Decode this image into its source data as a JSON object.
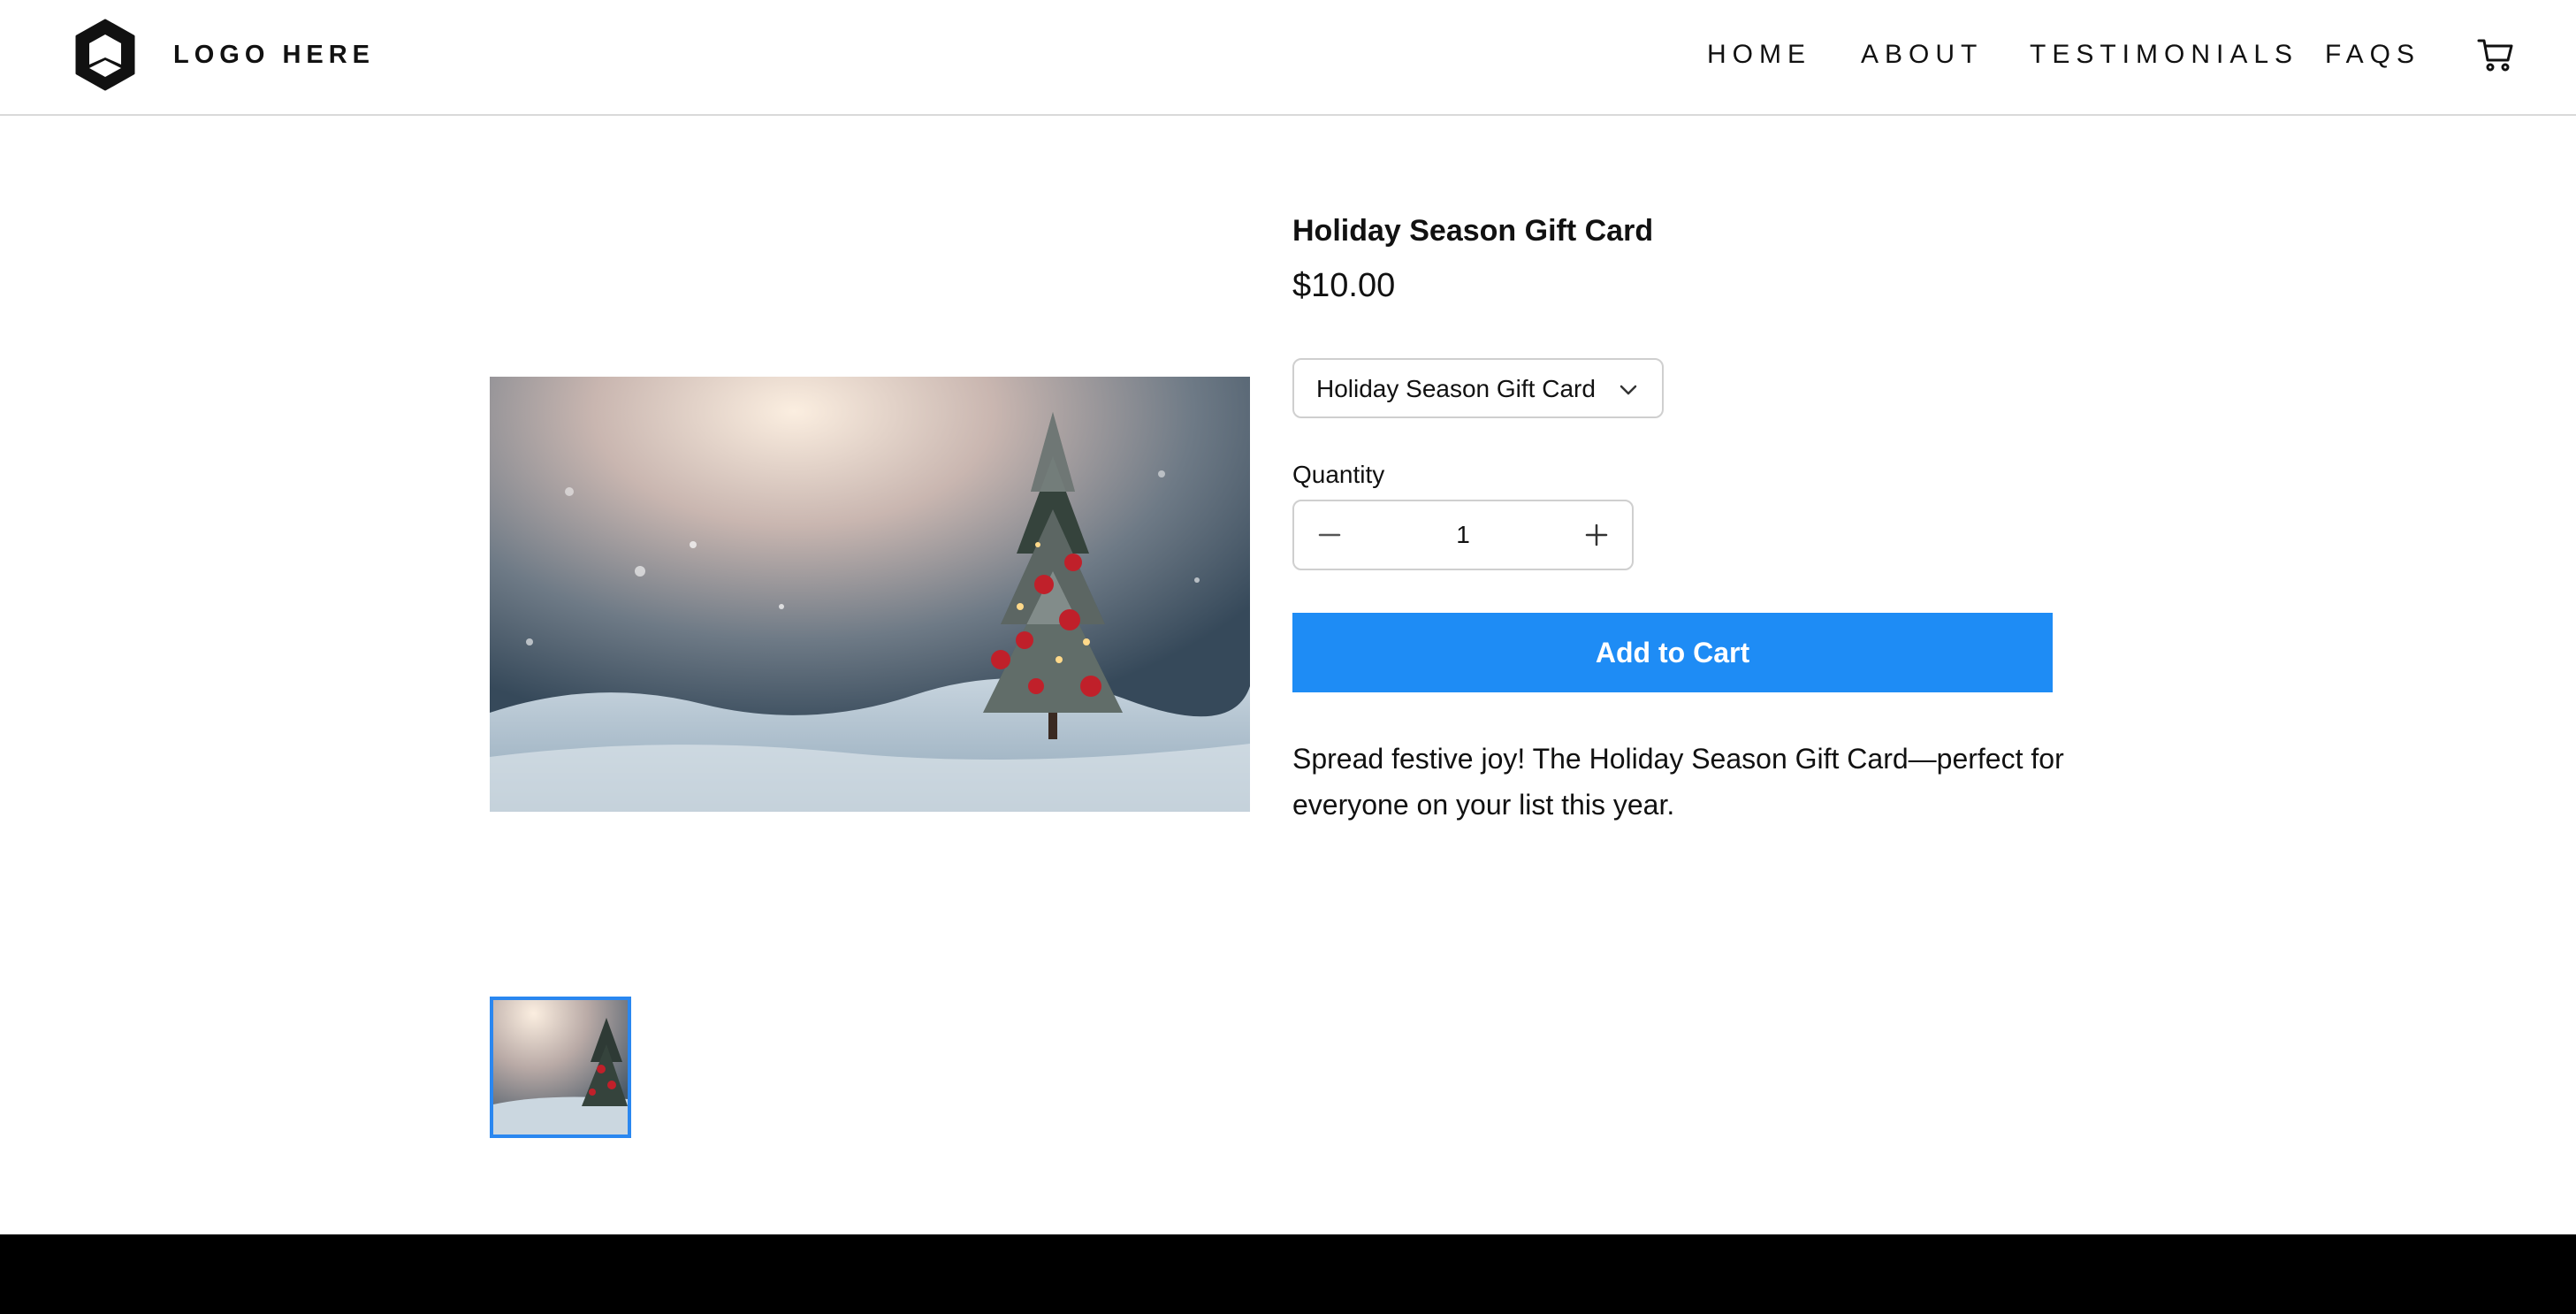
{
  "header": {
    "logo_text": "LOGO HERE",
    "nav": [
      {
        "label": "HOME"
      },
      {
        "label": "ABOUT"
      },
      {
        "label": "TESTIMONIALS"
      },
      {
        "label": "FAQS"
      }
    ],
    "cart_icon": "cart-icon"
  },
  "product": {
    "title": "Holiday Season Gift Card",
    "price": "$10.00",
    "variant": {
      "selected": "Holiday Season Gift Card",
      "icon": "chevron-down-icon"
    },
    "quantity": {
      "label": "Quantity",
      "value": "1",
      "decrement_icon": "minus-icon",
      "increment_icon": "plus-icon"
    },
    "add_to_cart_label": "Add to Cart",
    "description": "Spread festive joy! The Holiday Season Gift Card—perfect for everyone on your list this year."
  },
  "colors": {
    "accent": "#1e8cf5",
    "thumb_border": "#2a87f0",
    "footer": "#000000"
  }
}
